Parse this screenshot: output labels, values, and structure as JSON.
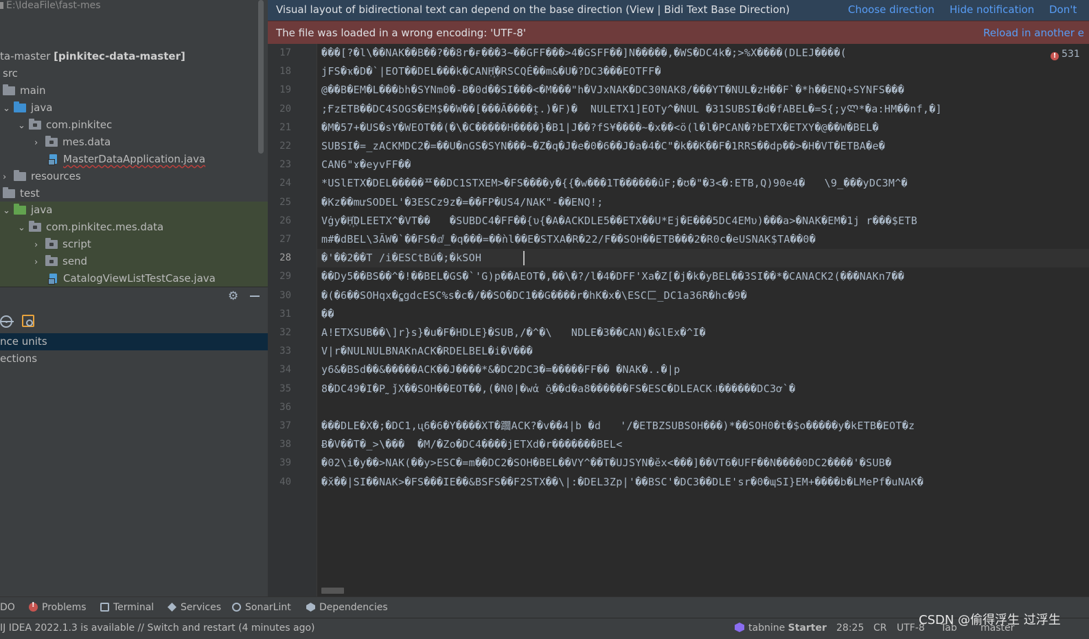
{
  "project": {
    "path": "E:\\IdeaFile\\fast-mes",
    "tree": {
      "module": "ta-master",
      "module_bold": "[pinkitec-data-master]",
      "src": "src",
      "main": "main",
      "java1": "java",
      "pkg1": "com.pinkitec",
      "mes_data": "mes.data",
      "master_file": "MasterDataApplication.java",
      "resources": "resources",
      "test": "test",
      "java2": "java",
      "pkg2": "com.pinkitec.mes.data",
      "script": "script",
      "send": "send",
      "test_file": "CatalogViewListTestCase.java"
    },
    "toolwindow_rows": [
      "nce units",
      "ections"
    ]
  },
  "notifications": {
    "bidi": {
      "message": "Visual layout of bidirectional text can depend on the base direction (View | Bidi Text Base Direction)",
      "link1": "Choose direction",
      "link2": "Hide notification",
      "link3": "Don't"
    },
    "encoding": {
      "message": "The file was loaded in a wrong encoding: 'UTF-8'",
      "link": "Reload in another e"
    }
  },
  "editor": {
    "error_count": "531",
    "line_numbers": [
      "17",
      "18",
      "19",
      "20",
      "21",
      "22",
      "23",
      "24",
      "25",
      "26",
      "27",
      "28",
      "29",
      "30",
      "31",
      "32",
      "33",
      "34",
      "35",
      "36",
      "37",
      "38",
      "39",
      "40"
    ],
    "lines": [
      "���[?�l\\��NAK��B��?��8r�ғ���3~��GFF���>4�GSFF��]N�����,�WS�DC4k�;>%X����(DLEJ����(",
      "jFS�ҡ�D�`|EOT��DEL���k�CANH꙰�RSCQÉ��m&�U�?DC3���EOTFF�",
      "@��B�EM�L���bh�SYNm0�-Ƀ�0d��SI���<�M���\"h�VJxNAK�DC30NAK8/���YT�NUL�zH��F`�*h��ENQ+SYNFS���",
      ";ҒzETB��DC4SOGS�EM$��W��[���Ã����ṱ.)�F)�  NULETX1]EOTy^�NUL �31SUBSI�d�fABEL�=S{;yᲚ*�a:HM��nf,�]",
      "�M�57+�US�sY�WEOT��(�\\�C�����H����}�B1|J��?fS¥����~�x��<ö(l�l�PCAN�?bETX�ETXY�@��W�BEL�",
      "SUBSI�=_zACKMDC2�=��U�nGS�SYN���~�Z�q�J�e�0�6��J�a�4�C\"�k��K��F�1RRS��dp��>�H�VT�ETBA�e�",
      "CAN6\"ɤ�eyvFF��",
      "*USlETX�DEL�����ᄑ��DC1STXEM>�FS����y�{{�w���1T������ûF;�ʊ�\"�3<�:ETB,Q)90e4�   \\9_���yDC3M^�",
      "�Kz��mưSODEL'�3ESCz9z�=��FP�US4/NAK\"-��ENQ!;",
      "Vġy�H꙰DLEETX^�VT��   �SUBDC4�FF��{υ{�A�ACKDLE5��ETX��U*Ej�E���5DC4EMυ)���a>�NAK�EM�1j r���$ETB",
      "m#�dBEL\\3ӐW�`��FS�ⅆ_�q���=��ǹl��E�STXA�R�22/F��SOH��ETB���2�R0c�eUSNAK$TA��0�",
      "�'��2��T /i�ESCtBú�;�kSOH",
      "��Dy5��BS��^�!��BEL�GS�`'G)p��AEOT�,��\\�?/l�4�DFF'Xa�Z[�j�k�yBEL��3SI��*�CANACK2(���NAKn7��",
      "�(�6��SOHqx�ꞔ͇gdcESC%s�c�/��SO�DC1��G����r�hK�x�\\ESC匚_DC1a36R�hc�9�",
      "��",
      "A!ETXSUB��\\]r}s}�u�F�HDLE}�SUB,/�^�\\   NDLE�3��CAN)�&lEx�^I�",
      "V|r�NULNULBNAKnACK�RDELBEL�i�V���",
      "y6&�BSd��&�����ACK��Ј����*&�DC2DC3�=�����FF�� �NAK�..�|p",
      "8�DC49�I�P˷ǰX��SOH��EOT��,(�N0|�wἀ ǒ͍��d�a8������FS�ESC�DLEACK꜋������DC3ơ`�",
      "",
      "���DLE�X�;�DC1,ᶙ6�6�Y����XT�躢ACK?�v��4|b �d   '/�ETBZSUBSOH���)*��SOH0�t�$o�����y�kETB�EOT�z",
      "Ƀ�V��T�_>\\���  �M/�Zo�DC4����jETXd�r�������BEL<",
      "�02\\i�y��>NAK(��y>ESC�=m��DC2�SOH�BEL��VY^��T�UJSYN�ĕx<���]��VT6�UFF��N����0DC2����'�SUB�",
      "�x̆��|SI��NAK>�FS���IE��&BSFS��F2STX��\\|:�DEL3Zp|'��BSC'�DC3��DLE'sr�0�ɰSI}EM+����b�LMePf�uNAK�"
    ]
  },
  "tool_tabs": [
    "DO",
    "Problems",
    "Terminal",
    "Services",
    "SonarLint",
    "Dependencies"
  ],
  "status": {
    "update_msg": "IJ IDEA 2022.1.3 is available // Switch and restart (4 minutes ago)",
    "tabnine": "tabnine",
    "tabnine_plan": "Starter",
    "position": "28:25",
    "line_sep": "CR",
    "encoding": "UTF-8",
    "indent": "Tab",
    "branch": "master"
  },
  "watermark": "CSDN @偷得浮生 过浮生"
}
